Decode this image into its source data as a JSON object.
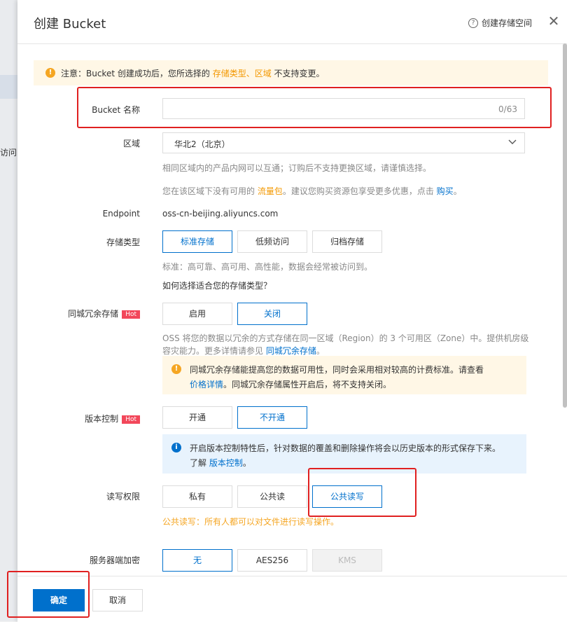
{
  "background": {
    "partial_text": "访问"
  },
  "dialog": {
    "title": "创建 Bucket",
    "help_link": "创建存储空间"
  },
  "notice": {
    "prefix": "注意：Bucket 创建成功后，您所选择的 ",
    "highlight1": "存储类型",
    "sep": "、",
    "highlight2": "区域",
    "suffix": " 不支持变更。"
  },
  "bucket_name": {
    "label": "Bucket 名称",
    "value": "",
    "counter": "0/63"
  },
  "region": {
    "label": "区域",
    "selected": "华北2（北京）",
    "hint": "相同区域内的产品内网可以互通；订购后不支持更换区域，请谨慎选择。",
    "promo_prefix": "您在该区域下没有可用的 ",
    "promo_link": "流量包",
    "promo_mid": "。建议您购买资源包享受更多优惠，点击 ",
    "promo_buy": "购买",
    "promo_end": "。"
  },
  "endpoint": {
    "label": "Endpoint",
    "value": "oss-cn-beijing.aliyuncs.com"
  },
  "storage_class": {
    "label": "存储类型",
    "options": [
      "标准存储",
      "低频访问",
      "归档存储"
    ],
    "selected": "标准存储",
    "hint": "标准：高可靠、高可用、高性能，数据会经常被访问到。",
    "help_link": "如何选择适合您的存储类型？"
  },
  "zone_redundancy": {
    "label": "同城冗余存储",
    "badge": "Hot",
    "options": [
      "启用",
      "关闭"
    ],
    "selected": "关闭",
    "desc_line1": "OSS 将您的数据以冗余的方式存储在同一区域（Region）的 3 个可用区（Zone）中。提供机房级",
    "desc_line2_prefix": "容灾能力。更多详情请参见 ",
    "desc_link": "同城冗余存储",
    "desc_end": "。",
    "warn_line1": "同城冗余存储能提高您的数据可用性，同时会采用相对较高的计费标准。请查看",
    "warn_link": "价格详情",
    "warn_line2": "。同城冗余存储属性开启后，将不支持关闭。"
  },
  "versioning": {
    "label": "版本控制",
    "badge": "Hot",
    "options": [
      "开通",
      "不开通"
    ],
    "selected": "不开通",
    "info_line1": "开启版本控制特性后，针对数据的覆盖和删除操作将会以历史版本的形式保存下来。",
    "info_prefix": "了解 ",
    "info_link": "版本控制",
    "info_end": "。"
  },
  "acl": {
    "label": "读写权限",
    "options": [
      "私有",
      "公共读",
      "公共读写"
    ],
    "selected": "公共读写",
    "note": "公共读写：所有人都可以对文件进行读写操作。"
  },
  "encryption": {
    "label": "服务器端加密",
    "options": [
      "无",
      "AES256",
      "KMS"
    ],
    "selected": "无"
  },
  "footer": {
    "ok": "确定",
    "cancel": "取消"
  },
  "colors": {
    "primary": "#0070cc",
    "accent": "#f39800",
    "highlight": "#e02020"
  }
}
